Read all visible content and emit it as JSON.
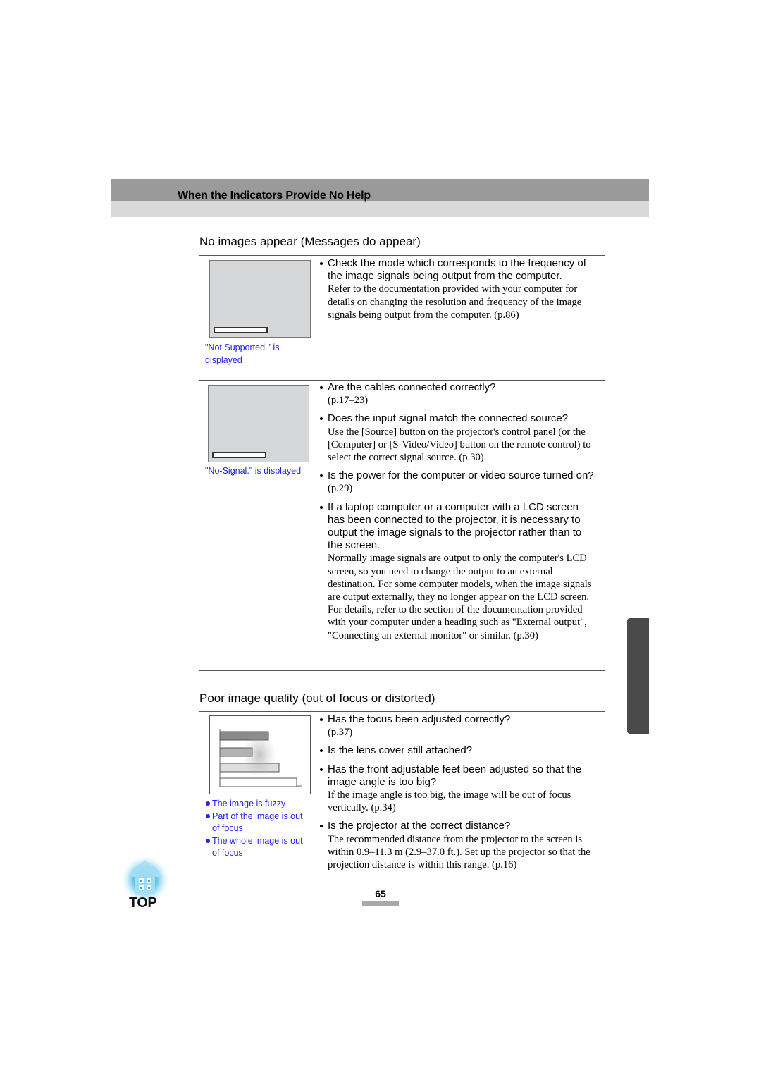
{
  "header": {
    "title": "When the Indicators Provide No Help"
  },
  "section1": {
    "title": "No images appear (Messages do appear)",
    "rows": [
      {
        "caption": "\"Not Supported.\" is displayed",
        "items": [
          {
            "q": "Check the mode which corresponds to the frequency of the image signals being output from the computer.",
            "d": "Refer to the documentation provided with your computer for details on changing the resolution and frequency of the image signals being output from the computer. (p.86)"
          }
        ]
      },
      {
        "caption": "\"No-Signal.\" is displayed",
        "items": [
          {
            "q": "Are the cables connected correctly?",
            "d": "(p.17–23)"
          },
          {
            "q": "Does the input signal match the connected source?",
            "d": "Use the [Source] button on the projector's control panel (or the [Computer] or [S-Video/Video] button on the remote control) to select the correct signal source. (p.30)"
          },
          {
            "q": "Is the power for the computer or video source turned on?",
            "d": "(p.29)"
          },
          {
            "q": "If a laptop computer or a computer with a LCD screen has been connected to the projector, it is necessary to output the image signals to the projector rather than to the screen.",
            "d": "Normally image signals are output to only the computer's LCD screen, so you need to change the output to an external destination. For some computer models, when the image signals are output externally, they no longer appear on the LCD screen. For details, refer to the section of the documentation provided with your computer under a heading such as \"External output\", \"Connecting an external monitor\" or similar. (p.30)"
          }
        ]
      }
    ]
  },
  "section2": {
    "title": "Poor image quality (out of focus or distorted)",
    "captions": [
      "The image is fuzzy",
      "Part of the image is out of focus",
      "The whole image is out of focus"
    ],
    "items": [
      {
        "q": "Has the focus been adjusted correctly?",
        "d": "(p.37)"
      },
      {
        "q": "Is the lens cover still attached?",
        "d": ""
      },
      {
        "q": "Has the front adjustable feet been adjusted so that the image angle is too big?",
        "d": "If the image angle is too big, the image will be out of focus vertically. (p.34)"
      },
      {
        "q": "Is the projector at the correct distance?",
        "d": "The recommended distance from the projector to the screen is within 0.9–11.3 m (2.9–37.0 ft.). Set up the projector so that the projection distance is within this range. (p.16)"
      }
    ]
  },
  "footer": {
    "top_label": "TOP",
    "page_number": "65"
  },
  "colors": {
    "caption_blue": "#2222ee",
    "header_dark": "#9a9a9a",
    "header_light": "#d9d9d9",
    "side_tab": "#4a4a4a"
  }
}
